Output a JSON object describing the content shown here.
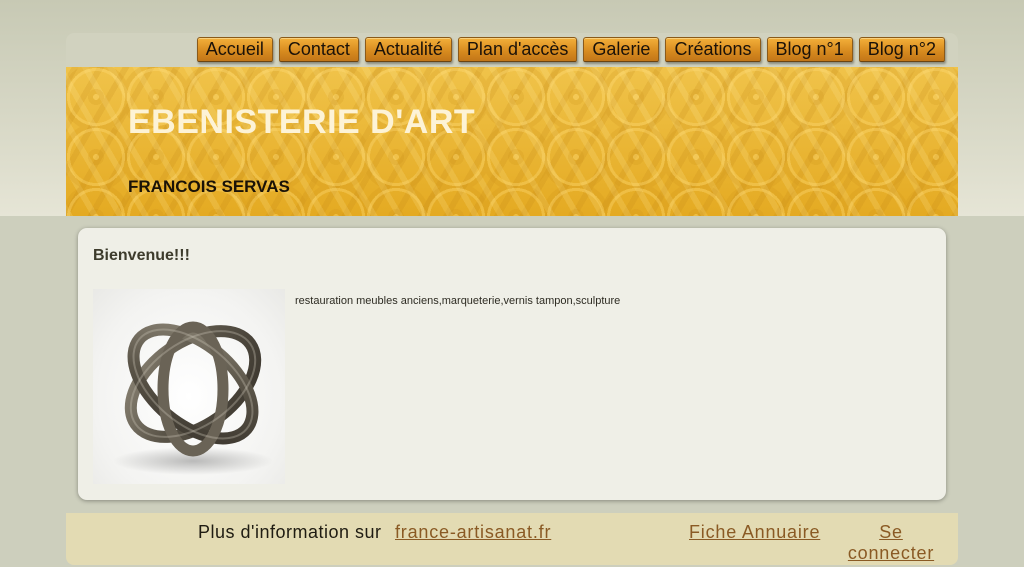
{
  "nav": {
    "items": [
      {
        "label": "Accueil"
      },
      {
        "label": "Contact"
      },
      {
        "label": "Actualité"
      },
      {
        "label": "Plan d'accès"
      },
      {
        "label": "Galerie"
      },
      {
        "label": "Créations"
      },
      {
        "label": "Blog n°1"
      },
      {
        "label": "Blog n°2"
      }
    ]
  },
  "header": {
    "title": "EBENISTERIE D'ART",
    "subtitle": "FRANCOIS SERVAS"
  },
  "content": {
    "heading": "Bienvenue!!!",
    "image_icon": "metal-ring-sculpture",
    "description": "restauration meubles anciens,marqueterie,vernis tampon,sculpture"
  },
  "footer": {
    "info_text": "Plus d'information sur",
    "artisanat_link": "france-artisanat.fr",
    "annuaire_link": "Fiche Annuaire",
    "login_link": "Se connecter"
  },
  "colors": {
    "header_gold": "#e7b32b",
    "nav_orange": "#d6891e",
    "link_brown": "#8a5a24"
  }
}
